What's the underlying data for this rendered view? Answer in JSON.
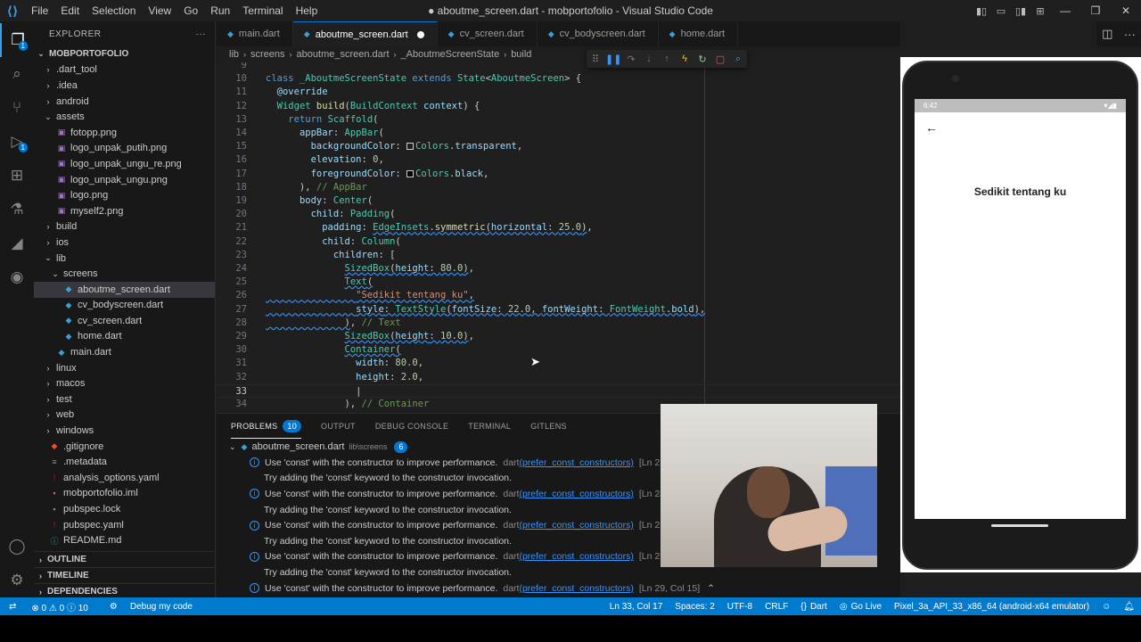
{
  "titlebar": {
    "title": "● aboutme_screen.dart - mobportofolio - Visual Studio Code",
    "menu": [
      "File",
      "Edit",
      "Selection",
      "View",
      "Go",
      "Run",
      "Terminal",
      "Help"
    ]
  },
  "activity": {
    "explorer_badge": "1",
    "debug_badge": "1"
  },
  "explorer": {
    "header": "EXPLORER",
    "more": "···",
    "root": "MOBPORTOFOLIO",
    "items": [
      {
        "label": ".dart_tool",
        "type": "folder",
        "depth": 1,
        "open": false
      },
      {
        "label": ".idea",
        "type": "folder",
        "depth": 1,
        "open": false
      },
      {
        "label": "android",
        "type": "folder",
        "depth": 1,
        "open": false
      },
      {
        "label": "assets",
        "type": "folder",
        "depth": 1,
        "open": true
      },
      {
        "label": "fotopp.png",
        "type": "image",
        "depth": 2
      },
      {
        "label": "logo_unpak_putih.png",
        "type": "image",
        "depth": 2
      },
      {
        "label": "logo_unpak_ungu_re.png",
        "type": "image",
        "depth": 2
      },
      {
        "label": "logo_unpak_ungu.png",
        "type": "image",
        "depth": 2
      },
      {
        "label": "logo.png",
        "type": "image",
        "depth": 2
      },
      {
        "label": "myself2.png",
        "type": "image",
        "depth": 2
      },
      {
        "label": "build",
        "type": "folder",
        "depth": 1,
        "open": false
      },
      {
        "label": "ios",
        "type": "folder",
        "depth": 1,
        "open": false
      },
      {
        "label": "lib",
        "type": "folder",
        "depth": 1,
        "open": true
      },
      {
        "label": "screens",
        "type": "folder",
        "depth": 2,
        "open": true
      },
      {
        "label": "aboutme_screen.dart",
        "type": "dart",
        "depth": 3,
        "selected": true
      },
      {
        "label": "cv_bodyscreen.dart",
        "type": "dart",
        "depth": 3
      },
      {
        "label": "cv_screen.dart",
        "type": "dart",
        "depth": 3
      },
      {
        "label": "home.dart",
        "type": "dart",
        "depth": 3
      },
      {
        "label": "main.dart",
        "type": "dart",
        "depth": 2
      },
      {
        "label": "linux",
        "type": "folder",
        "depth": 1,
        "open": false
      },
      {
        "label": "macos",
        "type": "folder",
        "depth": 1,
        "open": false
      },
      {
        "label": "test",
        "type": "folder",
        "depth": 1,
        "open": false
      },
      {
        "label": "web",
        "type": "folder",
        "depth": 1,
        "open": false
      },
      {
        "label": "windows",
        "type": "folder",
        "depth": 1,
        "open": false
      },
      {
        "label": ".gitignore",
        "type": "git",
        "depth": 1
      },
      {
        "label": ".metadata",
        "type": "meta",
        "depth": 1
      },
      {
        "label": "analysis_options.yaml",
        "type": "yaml",
        "depth": 1
      },
      {
        "label": "mobportofolio.iml",
        "type": "iml",
        "depth": 1
      },
      {
        "label": "pubspec.lock",
        "type": "lock",
        "depth": 1
      },
      {
        "label": "pubspec.yaml",
        "type": "yaml",
        "depth": 1
      },
      {
        "label": "README.md",
        "type": "md",
        "depth": 1
      }
    ],
    "sections": [
      "OUTLINE",
      "TIMELINE",
      "DEPENDENCIES"
    ]
  },
  "tabs": [
    {
      "label": "main.dart",
      "active": false
    },
    {
      "label": "aboutme_screen.dart",
      "active": true,
      "modified": true
    },
    {
      "label": "cv_screen.dart",
      "active": false
    },
    {
      "label": "cv_bodyscreen.dart",
      "active": false
    },
    {
      "label": "home.dart",
      "active": false
    }
  ],
  "breadcrumb": [
    "lib",
    "screens",
    "aboutme_screen.dart",
    "_AboutmeScreenState",
    "build"
  ],
  "editor": {
    "current_line": 33,
    "lines": [
      {
        "n": "9",
        "html": ""
      },
      {
        "n": "10",
        "html": "<span class='kw'>class</span> <span class='ty'>_AboutmeScreenState</span> <span class='kw'>extends</span> <span class='ty'>State</span>&lt;<span class='ty'>AboutmeScreen</span>&gt; {"
      },
      {
        "n": "11",
        "html": "  <span class='an'>@override</span>"
      },
      {
        "n": "12",
        "html": "  <span class='ty'>Widget</span> <span class='fn'>build</span>(<span class='ty'>BuildContext</span> <span class='pr'>context</span>) {"
      },
      {
        "n": "13",
        "html": "    <span class='kw'>return</span> <span class='ty'>Scaffold</span>("
      },
      {
        "n": "14",
        "html": "      <span class='pr'>appBar</span>: <span class='ty'>AppBar</span>("
      },
      {
        "n": "15",
        "html": "        <span class='pr'>backgroundColor</span>: <span class='sw'></span><span class='ty'>Colors</span>.<span class='pr'>transparent</span>,"
      },
      {
        "n": "16",
        "html": "        <span class='pr'>elevation</span>: <span class='nu'>0</span>,"
      },
      {
        "n": "17",
        "html": "        <span class='pr'>foregroundColor</span>: <span class='sw black'></span><span class='ty'>Colors</span>.<span class='pr'>black</span>,"
      },
      {
        "n": "18",
        "html": "      ), <span class='cm'>// AppBar</span>"
      },
      {
        "n": "19",
        "html": "      <span class='pr'>body</span>: <span class='ty'>Center</span>("
      },
      {
        "n": "20",
        "html": "        <span class='pr'>child</span>: <span class='ty'>Padding</span>("
      },
      {
        "n": "21",
        "html": "          <span class='pr'>padding</span>: <span class='sq'><span class='ty'>EdgeInsets</span>.<span class='fn'>symmetric</span>(<span class='pr'>horizontal</span>: <span class='nu'>25.0</span>)</span>,"
      },
      {
        "n": "22",
        "html": "          <span class='pr'>child</span>: <span class='ty'>Column</span>("
      },
      {
        "n": "23",
        "html": "            <span class='pr'>children</span>: ["
      },
      {
        "n": "24",
        "html": "              <span class='sq'><span class='ty'>SizedBox</span>(<span class='pr'>height</span>: <span class='nu'>80.0</span>)</span>,"
      },
      {
        "n": "25",
        "html": "              <span class='sq'><span class='ty'>Text</span>(</span>"
      },
      {
        "n": "26",
        "html": "<span class='sq'>                <span class='st'>\"Sedikit tentang ku\"</span>,</span>"
      },
      {
        "n": "27",
        "html": "<span class='sq'>                <span class='pr'>style</span>: <span class='ty'>TextStyle</span>(<span class='pr'>fontSize</span>: <span class='nu'>22.0</span>, <span class='pr'>fontWeight</span>: <span class='ty'>FontWeight</span>.<span class='pr'>bold</span>),</span>"
      },
      {
        "n": "28",
        "html": "<span class='sq'>              )</span>, <span class='cm'>// Text</span>"
      },
      {
        "n": "29",
        "html": "              <span class='sq'><span class='ty'>SizedBox</span>(<span class='pr'>height</span>: <span class='nu'>10.0</span>)</span>,"
      },
      {
        "n": "30",
        "html": "              <span class='sq'><span class='ty'>Container</span>(</span>"
      },
      {
        "n": "31",
        "html": "                <span class='pr'>width</span>: <span class='nu'>80.0</span>,"
      },
      {
        "n": "32",
        "html": "                <span class='pr'>height</span>: <span class='nu'>2.0</span>,"
      },
      {
        "n": "33",
        "html": "                |"
      },
      {
        "n": "34",
        "html": "              ), <span class='cm'>// Container</span>"
      }
    ]
  },
  "panel": {
    "tabs": [
      {
        "label": "PROBLEMS",
        "badge": "10",
        "active": true
      },
      {
        "label": "OUTPUT"
      },
      {
        "label": "DEBUG CONSOLE"
      },
      {
        "label": "TERMINAL"
      },
      {
        "label": "GITLENS"
      }
    ],
    "file": {
      "name": "aboutme_screen.dart",
      "path": "lib\\screens",
      "count": "6"
    },
    "problems": [
      {
        "msg": "Use 'const' with the constructor to improve performance.",
        "src": "dart",
        "code": "(prefer_const_constructors)",
        "loc": "[Ln 21,",
        "hint": "Try adding the 'const' keyword to the constructor invocation."
      },
      {
        "msg": "Use 'const' with the constructor to improve performance.",
        "src": "dart",
        "code": "(prefer_const_constructors)",
        "loc": "[Ln 24,",
        "hint": "Try adding the 'const' keyword to the constructor invocation."
      },
      {
        "msg": "Use 'const' with the constructor to improve performance.",
        "src": "dart",
        "code": "(prefer_const_constructors)",
        "loc": "[Ln 25,",
        "hint": "Try adding the 'const' keyword to the constructor invocation."
      },
      {
        "msg": "Use 'const' with the constructor to improve performance.",
        "src": "dart",
        "code": "(prefer_const_constructors)",
        "loc": "[Ln 27,",
        "hint": "Try adding the 'const' keyword to the constructor invocation."
      },
      {
        "msg": "Use 'const' with the constructor to improve performance.",
        "src": "dart",
        "code": "(prefer_const_constructors)",
        "loc": "[Ln 29, Col 15]",
        "hint": ""
      }
    ]
  },
  "phone": {
    "time": "6:42",
    "text": "Sedikit tentang ku"
  },
  "statusbar": {
    "problems": "⊗ 0 ⚠ 0 ⓘ 10",
    "debug": "Debug my code",
    "position": "Ln 33, Col 17",
    "spaces": "Spaces: 2",
    "encoding": "UTF-8",
    "eol": "CRLF",
    "language": "Dart",
    "golive": "Go Live",
    "device": "Pixel_3a_API_33_x86_64 (android-x64 emulator)"
  },
  "colors": {
    "accent": "#007acc",
    "editor_bg": "#1f1f1f",
    "sidebar_bg": "#181818"
  }
}
